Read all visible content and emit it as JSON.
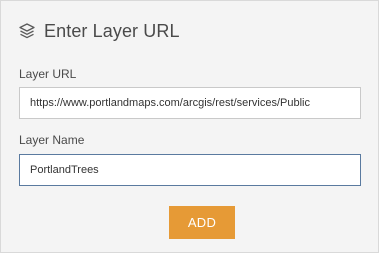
{
  "header": {
    "icon": "layers-icon",
    "title": "Enter Layer URL"
  },
  "layer_url": {
    "label": "Layer URL",
    "value": "https://www.portlandmaps.com/arcgis/rest/services/Public"
  },
  "layer_name": {
    "label": "Layer Name",
    "value": "PortlandTrees"
  },
  "actions": {
    "add_label": "ADD"
  },
  "colors": {
    "panel_bg": "#f4f4f4",
    "accent_button": "#e69a36",
    "focused_border": "#5a7a9f",
    "text": "#4a4a4a"
  }
}
